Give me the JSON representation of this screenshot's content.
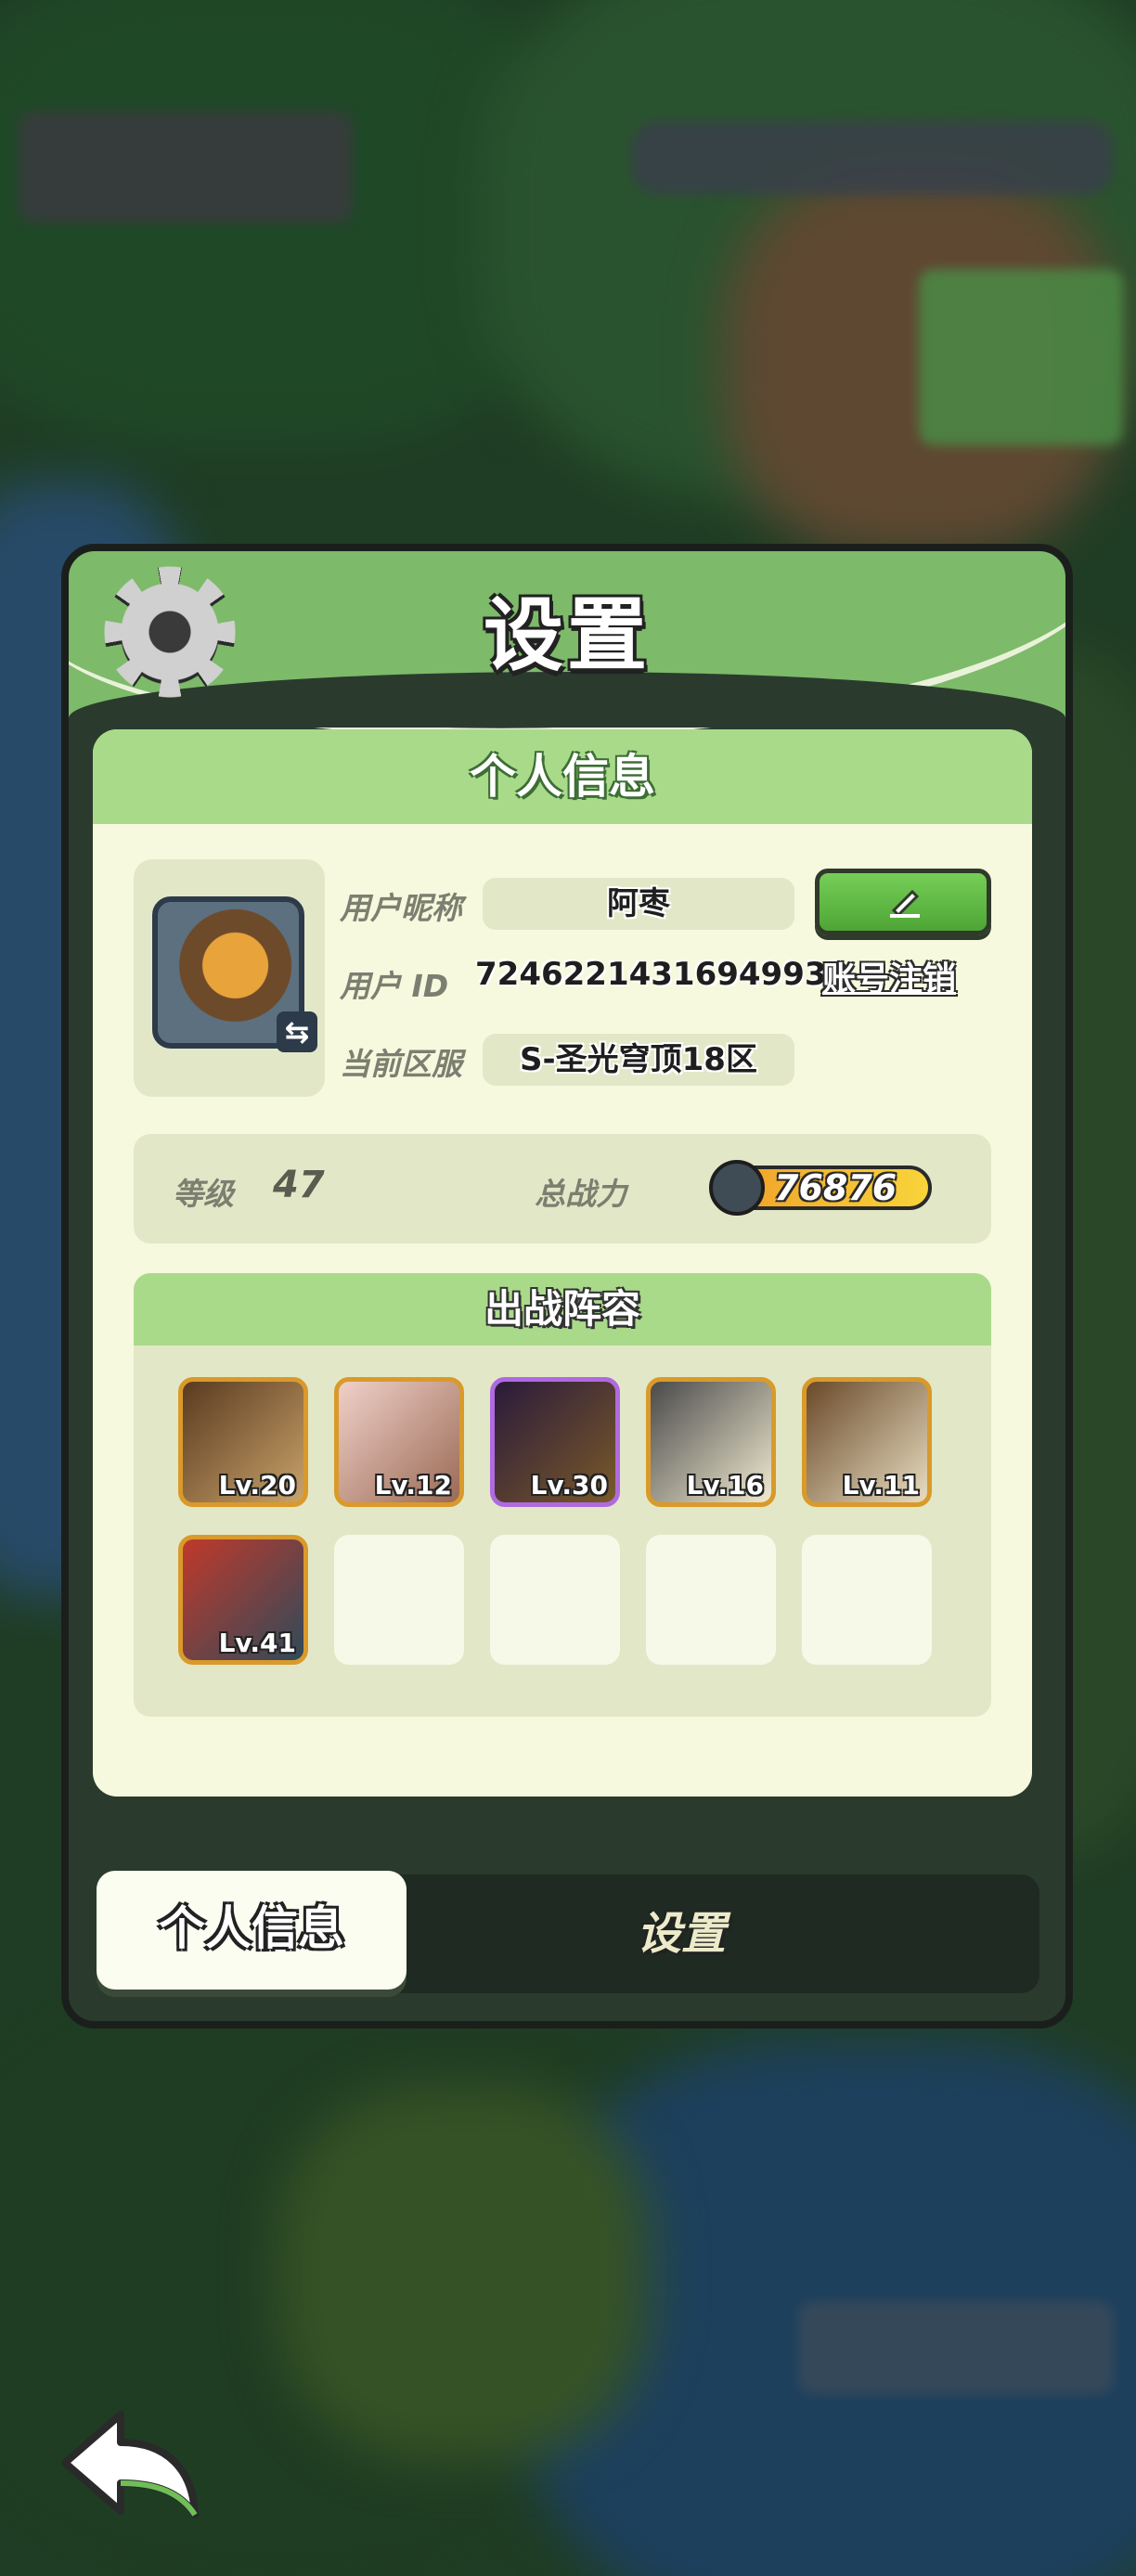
{
  "dialog": {
    "title": "设置"
  },
  "profile": {
    "header": "个人信息",
    "nickname_label": "用户昵称",
    "nickname_value": "阿枣",
    "user_id_label": "用户 ID",
    "user_id_value": "72462214316949938",
    "logout_link": "账号注销",
    "server_label": "当前区服",
    "server_value": "S-圣光穹顶18区"
  },
  "stats": {
    "level_label": "等级",
    "level_value": "47",
    "power_label": "总战力",
    "power_value": "76876"
  },
  "lineup": {
    "header": "出战阵容",
    "heroes": [
      {
        "level": "Lv.20",
        "color": "#8a5a2f"
      },
      {
        "level": "Lv.12",
        "color": "#c98f7a"
      },
      {
        "level": "Lv.30",
        "color": "#4a3050"
      },
      {
        "level": "Lv.16",
        "color": "#d8d0b0"
      },
      {
        "level": "Lv.11",
        "color": "#c8b890"
      },
      {
        "level": "Lv.41",
        "color": "#a33a2a"
      }
    ]
  },
  "tabs": {
    "personal_info": "个人信息",
    "settings": "设置"
  },
  "colors": {
    "accent_green": "#76cf57",
    "header_green": "#a9da8a",
    "card_cream": "#f6f9dd",
    "hero_border": "#d99a2b"
  }
}
